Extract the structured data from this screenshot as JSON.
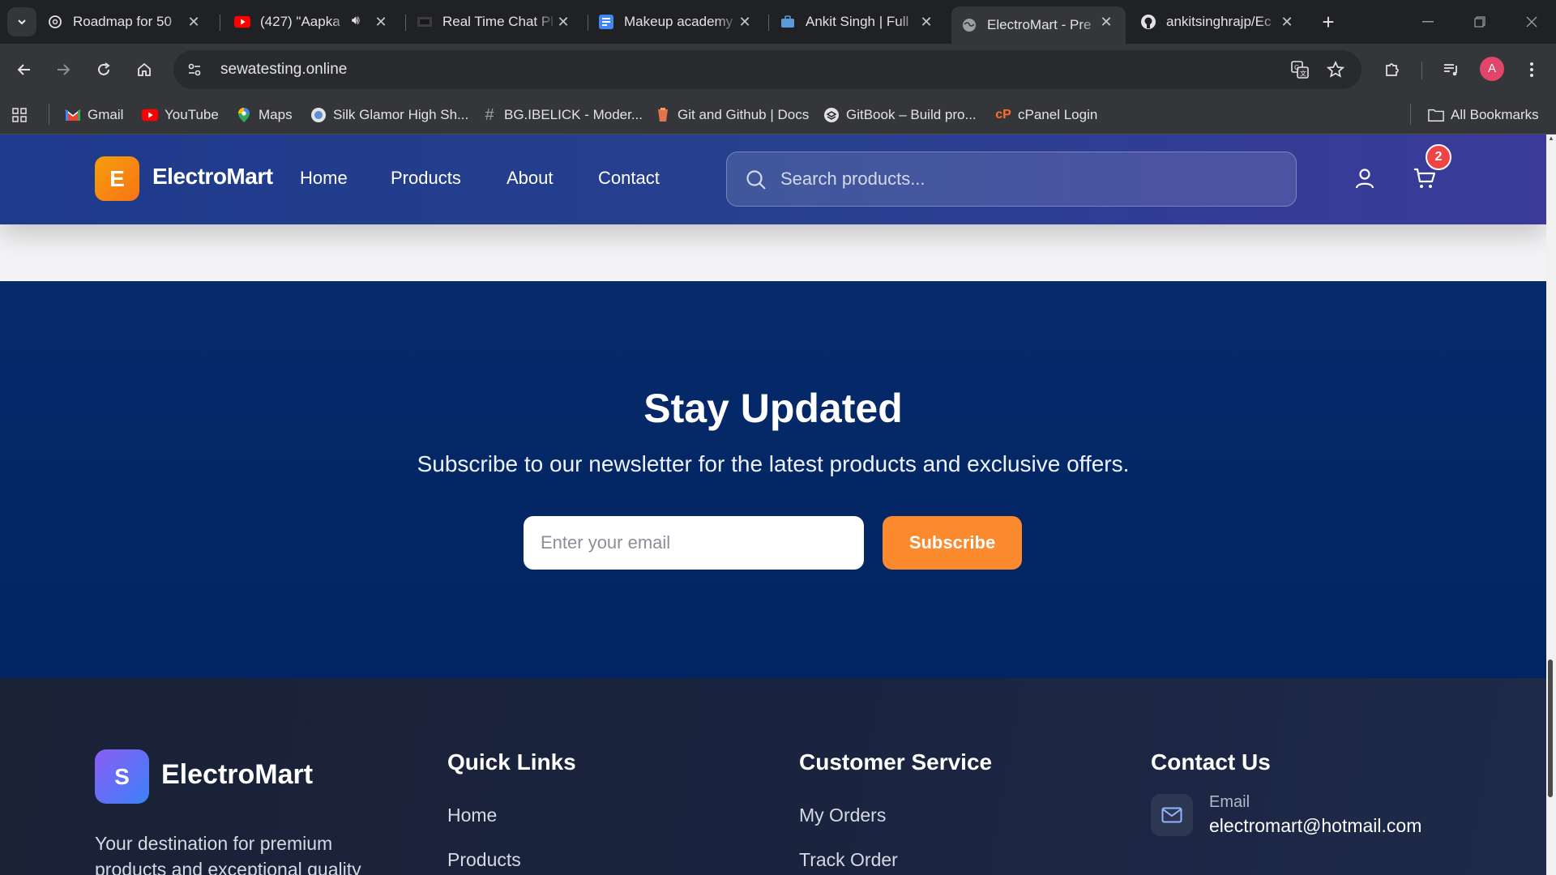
{
  "browser": {
    "tabs": [
      {
        "title": "Roadmap for 50",
        "icon": "openai-icon"
      },
      {
        "title": "(427) \"Aapka",
        "icon": "youtube-icon"
      },
      {
        "title": "Real Time Chat Pl",
        "icon": "page-icon"
      },
      {
        "title": "Makeup academy",
        "icon": "forms-icon"
      },
      {
        "title": "Ankit Singh | Full",
        "icon": "briefcase-icon"
      },
      {
        "title": "ElectroMart - Pre",
        "icon": "globe-icon",
        "active": true
      },
      {
        "title": "ankitsinghrajp/Ec",
        "icon": "github-icon"
      }
    ],
    "url": "sewatesting.online",
    "profile_initial": "A",
    "bookmarks": [
      {
        "label": "Gmail",
        "icon": "gmail-icon"
      },
      {
        "label": "YouTube",
        "icon": "youtube-icon"
      },
      {
        "label": "Maps",
        "icon": "maps-icon"
      },
      {
        "label": "Silk Glamor High Sh...",
        "icon": "site-icon"
      },
      {
        "label": "BG.IBELICK - Moder...",
        "icon": "hash-icon"
      },
      {
        "label": "Git and Github | Docs",
        "icon": "git-icon"
      },
      {
        "label": "GitBook – Build pro...",
        "icon": "gitbook-icon"
      },
      {
        "label": "cPanel Login",
        "icon": "cpanel-icon"
      }
    ],
    "all_bookmarks": "All Bookmarks"
  },
  "header": {
    "logo_letter": "E",
    "brand": "ElectroMart",
    "nav": [
      "Home",
      "Products",
      "About",
      "Contact"
    ],
    "search_placeholder": "Search products...",
    "cart_count": "2"
  },
  "newsletter": {
    "title": "Stay Updated",
    "subtitle": "Subscribe to our newsletter for the latest products and exclusive offers.",
    "email_placeholder": "Enter your email",
    "button": "Subscribe"
  },
  "footer": {
    "logo_letter": "S",
    "brand": "ElectroMart",
    "description": "Your destination for premium products and exceptional quality",
    "quick_links": {
      "heading": "Quick Links",
      "items": [
        "Home",
        "Products"
      ]
    },
    "customer_service": {
      "heading": "Customer Service",
      "items": [
        "My Orders",
        "Track Order"
      ]
    },
    "contact": {
      "heading": "Contact Us",
      "email_label": "Email",
      "email": "electromart@hotmail.com"
    }
  },
  "colors": {
    "header_start": "#1e3a8a",
    "header_end": "#3b3a9a",
    "logo_orange": "#f97316",
    "newsletter_bg": "#032462",
    "subscribe_button": "#fb8a2e",
    "cart_badge": "#ef4444",
    "footer_bg": "#1b2440"
  }
}
